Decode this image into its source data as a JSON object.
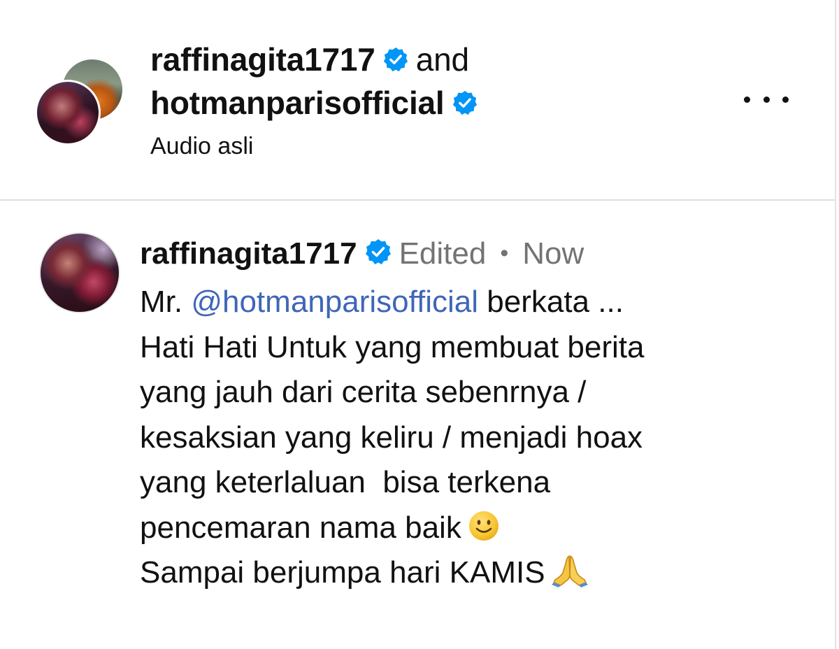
{
  "header": {
    "user1": "raffinagita1717",
    "conjunction": "and",
    "user2": "hotmanparisofficial",
    "audio_label": "Audio asli",
    "menu_icon": "more-horizontal-icon"
  },
  "comment": {
    "username": "raffinagita1717",
    "edited_label": "Edited",
    "separator": "•",
    "time": "Now",
    "line1_prefix": "Mr. ",
    "mention": "@hotmanparisofficial",
    "line1_suffix": " berkata ...",
    "line2": "Hati Hati Untuk yang membuat berita",
    "line3": "yang jauh dari cerita sebenrnya /",
    "line4": "kesaksian yang keliru / menjadi hoax",
    "line5": "yang keterlaluan  bisa terkena",
    "line6": "pencemaran nama baik",
    "line7": "Sampai berjumpa hari KAMIS"
  },
  "icons": {
    "verified": "verified-badge-icon",
    "smile": "slightly-smiling-face-icon",
    "pray": "folded-hands-icon"
  },
  "colors": {
    "verified_blue": "#0095f6",
    "mention_blue": "#3f66b8",
    "meta_gray": "#737373",
    "divider": "#dedede"
  }
}
